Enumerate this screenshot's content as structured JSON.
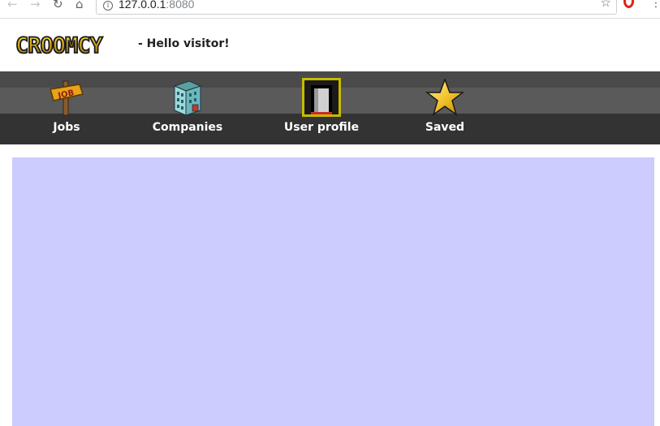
{
  "browser": {
    "back_icon": "arrow-left-icon",
    "forward_icon": "arrow-right-icon",
    "reload_icon": "reload-icon",
    "home_icon": "home-icon",
    "url_host": "127.0.0.1",
    "url_port": ":8080",
    "bookmark_icon": "star-outline-icon",
    "extension_icon": "opera-icon",
    "menu_icon": "kebab-menu-icon"
  },
  "header": {
    "logo_text": "CROOMCY",
    "tagline": "- Hello visitor!"
  },
  "nav": {
    "items": [
      {
        "label": "Jobs",
        "icon": "job-sign-icon"
      },
      {
        "label": "Companies",
        "icon": "building-icon"
      },
      {
        "label": "User profile",
        "icon": "door-icon"
      },
      {
        "label": "Saved",
        "icon": "star-icon"
      }
    ]
  },
  "colors": {
    "content_bg": "#ccccff",
    "nav_dark": "#333333",
    "nav_mid": "#5a5a5a",
    "logo_gold": "#d4a017"
  }
}
